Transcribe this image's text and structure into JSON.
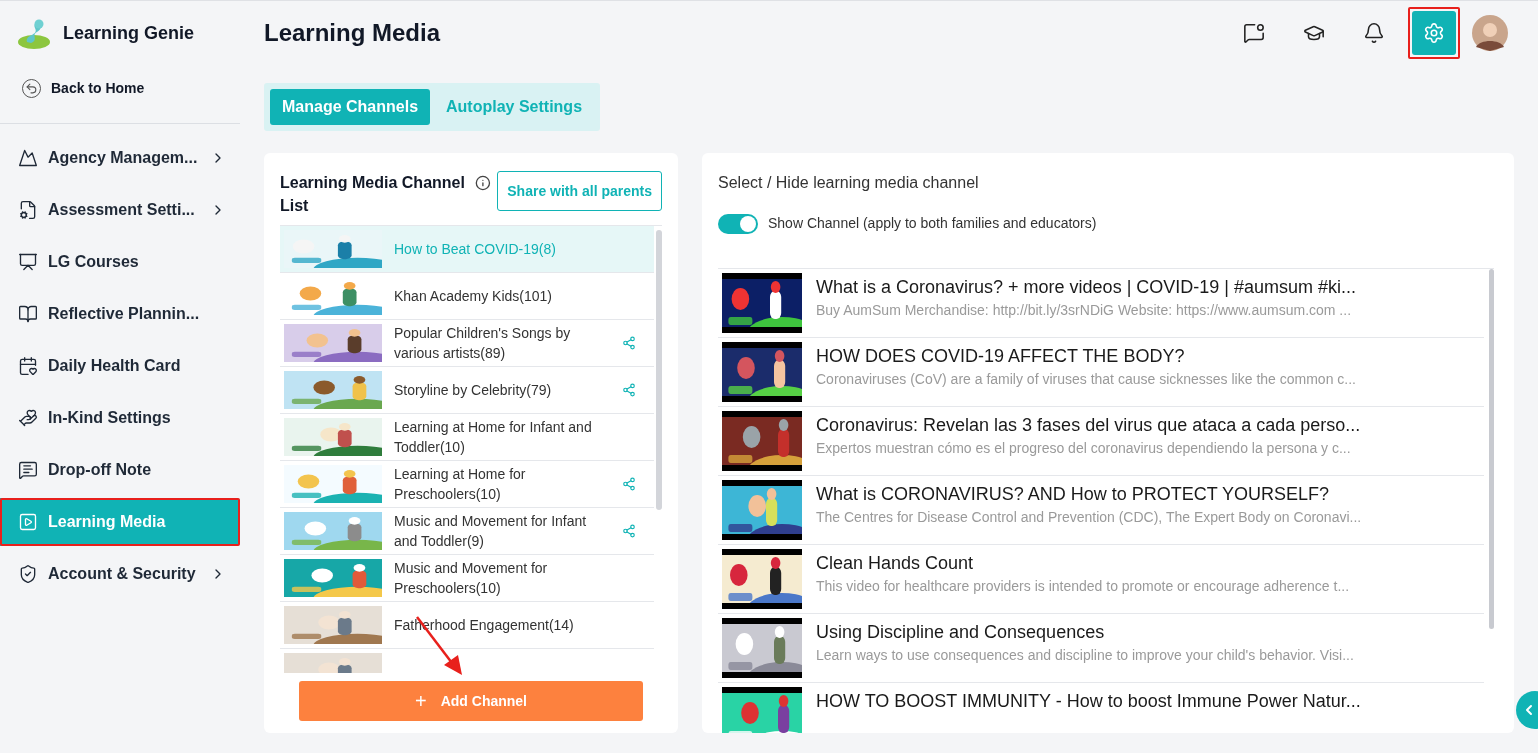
{
  "brand": {
    "name": "Learning Genie"
  },
  "back_link": "Back to Home",
  "sidebar": {
    "items": [
      {
        "label": "Agency Managem...",
        "submenu": true,
        "selected": false,
        "highlighted": false
      },
      {
        "label": "Assessment Setti...",
        "submenu": true,
        "selected": false,
        "highlighted": false
      },
      {
        "label": "LG Courses",
        "submenu": false,
        "selected": false,
        "highlighted": false
      },
      {
        "label": "Reflective Plannin...",
        "submenu": false,
        "selected": false,
        "highlighted": false
      },
      {
        "label": "Daily Health Card",
        "submenu": false,
        "selected": false,
        "highlighted": false
      },
      {
        "label": "In-Kind Settings",
        "submenu": false,
        "selected": false,
        "highlighted": false
      },
      {
        "label": "Drop-off Note",
        "submenu": false,
        "selected": false,
        "highlighted": false
      },
      {
        "label": "Learning Media",
        "submenu": false,
        "selected": true,
        "highlighted": true
      },
      {
        "label": "Account & Security",
        "submenu": true,
        "selected": false,
        "highlighted": false
      }
    ]
  },
  "page_title": "Learning Media",
  "toolbar": [
    {
      "selected": false,
      "highlighted": false
    },
    {
      "selected": false,
      "highlighted": false
    },
    {
      "selected": false,
      "highlighted": false
    },
    {
      "selected": true,
      "highlighted": true
    }
  ],
  "tabs": [
    {
      "label": "Manage Channels",
      "selected": true
    },
    {
      "label": "Autoplay Settings",
      "selected": false
    }
  ],
  "channel_list": {
    "title": "Learning Media Channel List",
    "share_button": "Share with all parents",
    "add_button": "Add Channel",
    "add_icon": "+",
    "items": [
      {
        "name": "How to Beat COVID-19(8)",
        "shared": false,
        "selected": true
      },
      {
        "name": "Khan Academy Kids(101)",
        "shared": false,
        "selected": false
      },
      {
        "name": "Popular Children's Songs by various artists(89)",
        "shared": true,
        "selected": false
      },
      {
        "name": "Storyline by Celebrity(79)",
        "shared": true,
        "selected": false
      },
      {
        "name": "Learning at Home for Infant and Toddler(10)",
        "shared": false,
        "selected": false
      },
      {
        "name": "Learning at Home for Preschoolers(10)",
        "shared": true,
        "selected": false
      },
      {
        "name": "Music and Movement for Infant and Toddler(9)",
        "shared": true,
        "selected": false
      },
      {
        "name": "Music and Movement for Preschoolers(10)",
        "shared": false,
        "selected": false
      },
      {
        "name": "Fatherhood Engagement(14)",
        "shared": false,
        "selected": false
      }
    ]
  },
  "channel_detail": {
    "title": "Select / Hide learning media channel",
    "toggle": {
      "label": "Show Channel (apply to both families and educators)",
      "on": true
    },
    "videos": [
      {
        "title": "What is a Coronavirus? + more videos | COVID-19 | #aumsum #ki...",
        "description": "Buy AumSum Merchandise: http://bit.ly/3srNDiG Website: https://www.aumsum.com ..."
      },
      {
        "title": "HOW DOES COVID-19 AFFECT THE BODY?",
        "description": "Coronaviruses (CoV) are a family of viruses that cause sicknesses like the common c..."
      },
      {
        "title": "Coronavirus: Revelan las 3 fases del virus que ataca a cada perso...",
        "description": "Expertos muestran cómo es el progreso del coronavirus dependiendo la persona y c..."
      },
      {
        "title": "What is CORONAVIRUS? AND How to PROTECT YOURSELF?",
        "description": "The Centres for Disease Control and Prevention (CDC), The Expert Body on Coronavi..."
      },
      {
        "title": "Clean Hands Count",
        "description": "This video for healthcare providers is intended to promote or encourage adherence t..."
      },
      {
        "title": "Using Discipline and Consequences",
        "description": "Learn ways to use consequences and discipline to improve your child's behavior. Visi..."
      },
      {
        "title": "HOW TO BOOST IMMUNITY - How to boost Immune Power Natur..."
      }
    ]
  }
}
